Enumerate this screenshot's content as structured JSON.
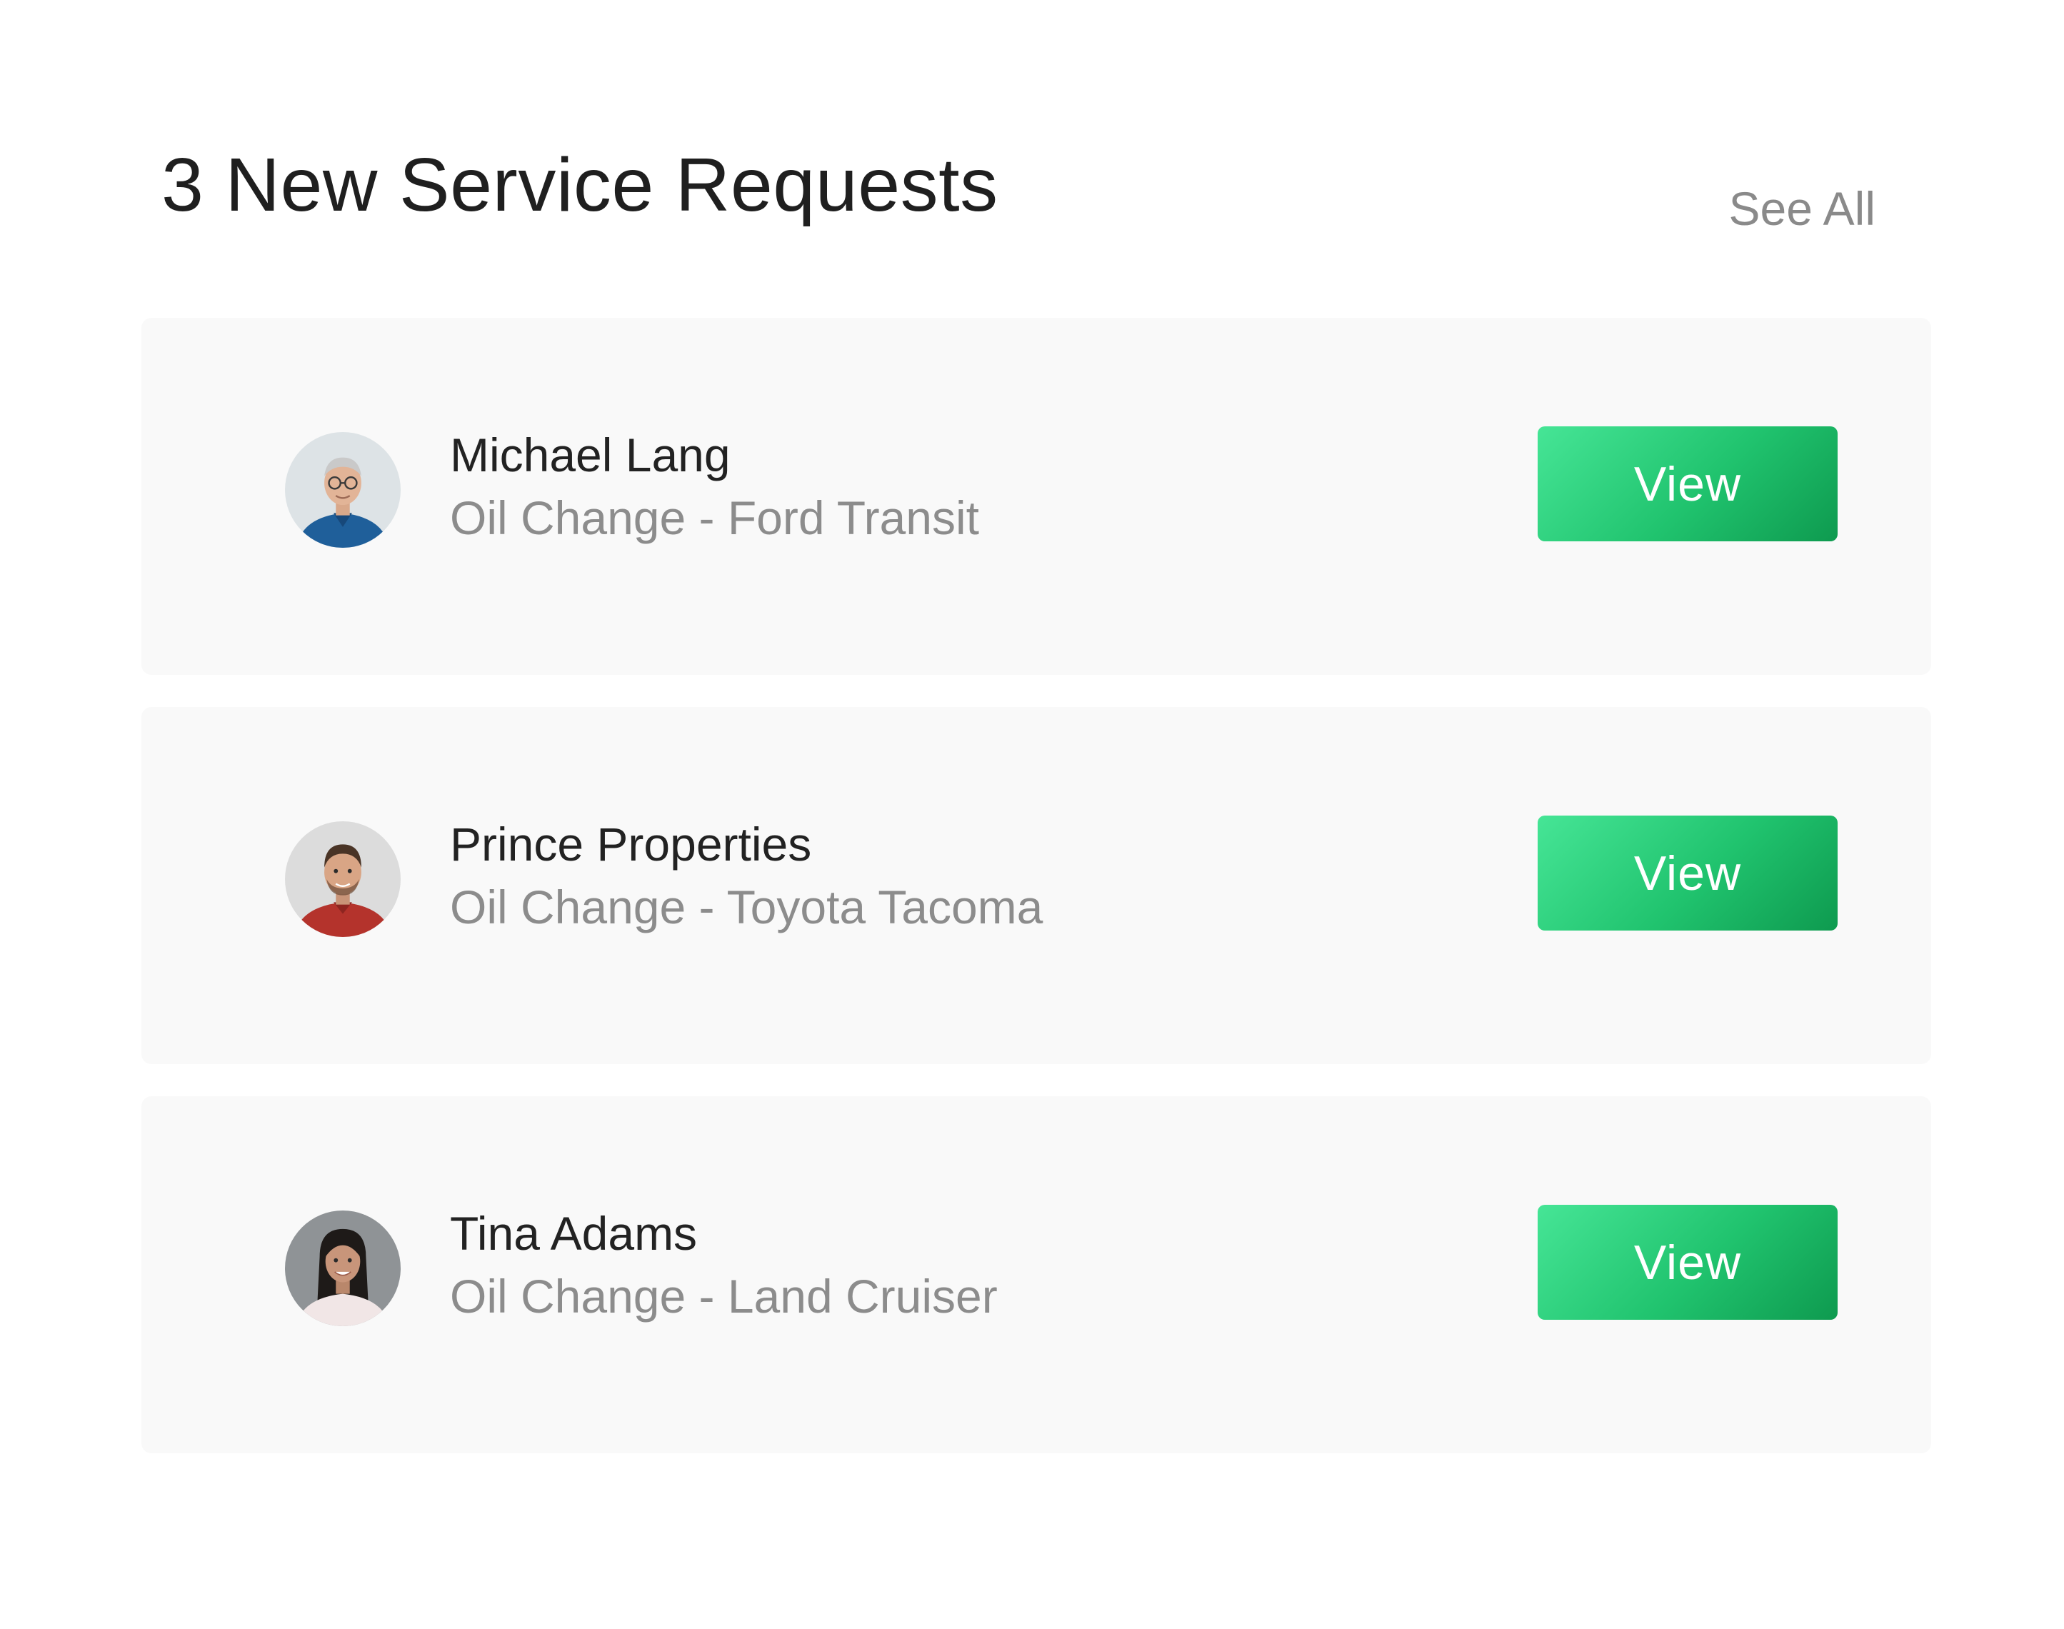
{
  "header": {
    "title": "3 New Service Requests",
    "see_all_label": "See All"
  },
  "requests": [
    {
      "name": "Michael Lang",
      "service": "Oil Change - Ford Transit",
      "action_label": "View",
      "avatar": "older-man-glasses-blue-shirt"
    },
    {
      "name": "Prince Properties",
      "service": "Oil Change - Toyota Tacoma",
      "action_label": "View",
      "avatar": "young-man-beard-red-shirt"
    },
    {
      "name": "Tina Adams",
      "service": "Oil Change - Land Cruiser",
      "action_label": "View",
      "avatar": "woman-dark-hair-light-top"
    }
  ],
  "colors": {
    "accent_start": "#46e596",
    "accent_end": "#0e9a4f",
    "card_background": "#f9f9f9",
    "muted_text": "#8c8c8c"
  }
}
